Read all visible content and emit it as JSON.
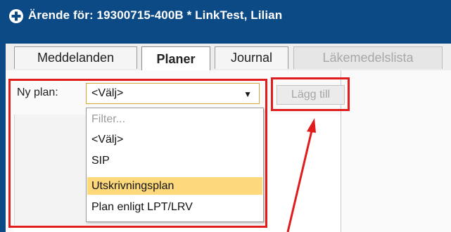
{
  "window": {
    "title": "Ärende för: 19300715-400B * LinkTest, Lilian",
    "icon": "plus-circle-icon",
    "titlebar_color": "#0c4a86"
  },
  "tabs": [
    {
      "label": "Meddelanden",
      "active": false,
      "disabled": false
    },
    {
      "label": "Planer",
      "active": true,
      "disabled": false
    },
    {
      "label": "Journal",
      "active": false,
      "disabled": false
    },
    {
      "label": "Läkemedelslista",
      "active": false,
      "disabled": true
    }
  ],
  "plan_form": {
    "label": "Ny plan:",
    "selected": "<Välj>",
    "add_button": "Lägg till",
    "add_button_enabled": false
  },
  "dropdown": {
    "filter_placeholder": "Filter...",
    "options": [
      "<Välj>",
      "SIP",
      "Utskrivningsplan",
      "Plan enligt LPT/LRV"
    ],
    "highlighted": "Utskrivningsplan",
    "highlight_color": "#fdd97c"
  },
  "annotations": {
    "color": "#e01c1c",
    "shapes": [
      "rectangle",
      "rectangle",
      "arrow"
    ]
  }
}
